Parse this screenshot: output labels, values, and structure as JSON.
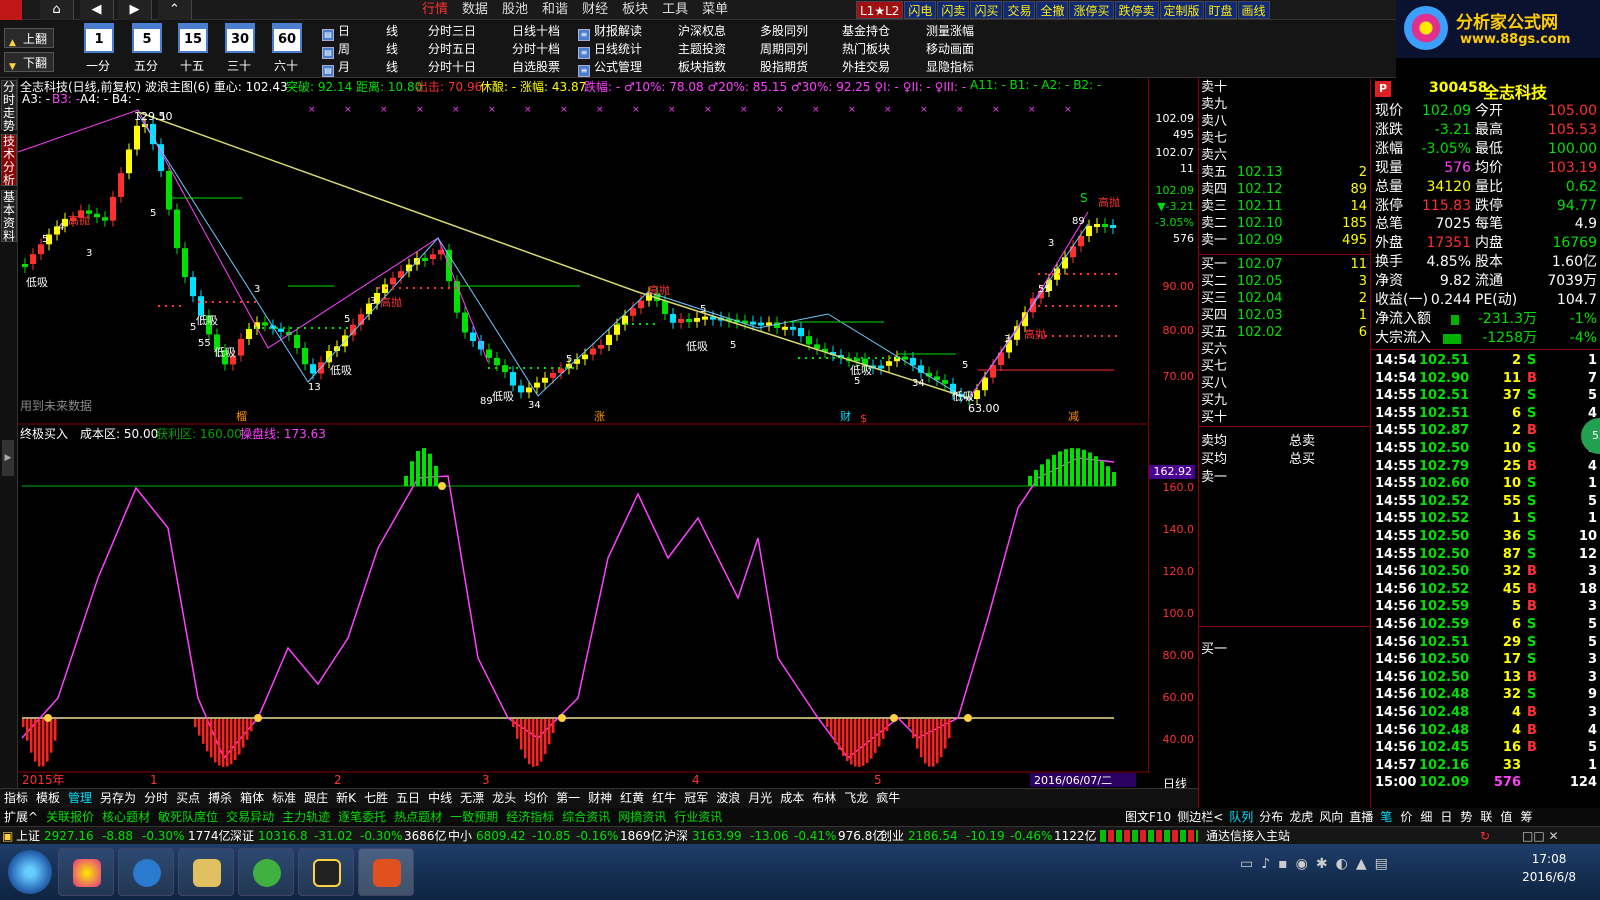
{
  "topbar": {
    "menu": [
      "行情",
      "数据",
      "股池",
      "和谐",
      "财经",
      "板块",
      "工具",
      "菜单"
    ],
    "tabs": [
      "L1★L2",
      "闪电",
      "闪卖",
      "闪买",
      "交易",
      "全撤",
      "涨停买",
      "跌停卖",
      "定制版",
      "盯盘",
      "画线"
    ]
  },
  "brand": {
    "name": "分析家公式网",
    "url": "www.88gs.com"
  },
  "toolbar": {
    "prev_page": "上翻",
    "next_page": "下翻",
    "periods": [
      {
        "num": "1",
        "label": "一分"
      },
      {
        "num": "5",
        "label": "五分"
      },
      {
        "num": "15",
        "label": "十五"
      },
      {
        "num": "30",
        "label": "三十"
      },
      {
        "num": "60",
        "label": "六十"
      }
    ],
    "cycle_rows": [
      {
        "day": "日",
        "line": "线"
      },
      {
        "day": "周",
        "line": "线"
      },
      {
        "day": "月",
        "line": "线"
      }
    ],
    "col1": [
      "分时三日",
      "分时五日",
      "分时十日"
    ],
    "col2": [
      "日线十档",
      "分时十档",
      "自选股票"
    ],
    "col3": [
      "财报解读",
      "日线统计",
      "公式管理"
    ],
    "col4": [
      "沪深权息",
      "主题投资",
      "板块指数"
    ],
    "col5": [
      "多股同列",
      "周期同列",
      "股指期货"
    ],
    "col6": [
      "基金持仓",
      "热门板块",
      "外挂交易"
    ],
    "col7": [
      "测量涨幅",
      "移动画面",
      "显隐指标"
    ]
  },
  "leftside": {
    "tab1": "分时走势",
    "tab2": "技术分析",
    "tab3": "基本资料"
  },
  "chart": {
    "info1": "全志科技(日线,前复权) 波浪主图(6) 重心: 102.43",
    "info2": "突破: 92.14 距离: 10.80",
    "info3": "出击: 70.96",
    "info4": "休酿:  - 涨幅: 43.87",
    "info5": "跌幅:  - ♂10%: 78.08 ♂20%: 85.15 ♂30%: 92.25 ♀I: - ♀II: - ♀III: -",
    "info6": "A11: - B1: - A2: - B2: -",
    "info7": "A3: -",
    "info8": "B3: -",
    "info9": "A4: - B4: -",
    "peak_label": "129.50",
    "low_label": "63.00",
    "future_note": "用到未来数据",
    "tags": [
      "低吸",
      "高抛",
      "低吸",
      "低吸",
      "低吸",
      "高抛",
      "低吸",
      "低吸",
      "高抛",
      "低吸",
      "低吸",
      "高抛",
      "高抛"
    ],
    "waves": [
      "5",
      "3",
      "4",
      "1",
      "5",
      "13",
      "5",
      "3",
      "89",
      "34",
      "55",
      "5",
      "3",
      "5",
      "5",
      "5",
      "89",
      "5",
      "34",
      "3",
      "5",
      "55",
      "3",
      "S"
    ],
    "bottom_marks": [
      "榴",
      "涨",
      "财",
      "$",
      "减"
    ]
  },
  "indicator": {
    "name": "终极买入",
    "cost": "成本区: 50.00",
    "profit": "获利区: 160.00",
    "line": "操盘线: 173.63",
    "marker": "162.92"
  },
  "price_axis": [
    "102.09",
    "495",
    "102.07",
    "11",
    "102.09",
    "▼-3.21",
    "-3.05%",
    "576",
    "90.00",
    "80.00",
    "70.00"
  ],
  "ind_axis": [
    "160.0",
    "140.0",
    "120.0",
    "100.0",
    "80.00",
    "60.00",
    "40.00"
  ],
  "xaxis": {
    "year": "2015年",
    "months": [
      "1",
      "2",
      "3",
      "4",
      "5"
    ],
    "date": "2016/06/07/二",
    "period": "日线"
  },
  "book": {
    "sells": [
      {
        "label": "卖十",
        "price": "",
        "vol": ""
      },
      {
        "label": "卖九",
        "price": "",
        "vol": ""
      },
      {
        "label": "卖八",
        "price": "",
        "vol": ""
      },
      {
        "label": "卖七",
        "price": "",
        "vol": ""
      },
      {
        "label": "卖六",
        "price": "",
        "vol": ""
      },
      {
        "label": "卖五",
        "price": "102.13",
        "vol": "2"
      },
      {
        "label": "卖四",
        "price": "102.12",
        "vol": "89"
      },
      {
        "label": "卖三",
        "price": "102.11",
        "vol": "14"
      },
      {
        "label": "卖二",
        "price": "102.10",
        "vol": "185"
      },
      {
        "label": "卖一",
        "price": "102.09",
        "vol": "495"
      }
    ],
    "buys": [
      {
        "label": "买一",
        "price": "102.07",
        "vol": "11"
      },
      {
        "label": "买二",
        "price": "102.05",
        "vol": "3"
      },
      {
        "label": "买三",
        "price": "102.04",
        "vol": "2"
      },
      {
        "label": "买四",
        "price": "102.03",
        "vol": "1"
      },
      {
        "label": "买五",
        "price": "102.02",
        "vol": "6"
      },
      {
        "label": "买六",
        "price": "",
        "vol": ""
      },
      {
        "label": "买七",
        "price": "",
        "vol": ""
      },
      {
        "label": "买八",
        "price": "",
        "vol": ""
      },
      {
        "label": "买九",
        "price": "",
        "vol": ""
      },
      {
        "label": "买十",
        "price": "",
        "vol": ""
      }
    ],
    "avg_sell": "卖均",
    "avg_buy": "买均",
    "total_sell": "总卖",
    "total_buy": "总买",
    "sell1": "卖一",
    "buy1": "买一"
  },
  "quote": {
    "code": "300458",
    "name": "全志科技",
    "rows": [
      {
        "l1": "现价",
        "v1": "102.09",
        "c1": "#00e000",
        "l2": "今开",
        "v2": "105.00",
        "c2": "#ff3030"
      },
      {
        "l1": "涨跌",
        "v1": "-3.21",
        "c1": "#00e000",
        "l2": "最高",
        "v2": "105.53",
        "c2": "#ff3030"
      },
      {
        "l1": "涨幅",
        "v1": "-3.05%",
        "c1": "#00e000",
        "l2": "最低",
        "v2": "100.00",
        "c2": "#00e000"
      },
      {
        "l1": "现量",
        "v1": "576",
        "c1": "#ff40ff",
        "l2": "均价",
        "v2": "103.19",
        "c2": "#ff3030"
      },
      {
        "l1": "总量",
        "v1": "34120",
        "c1": "#ffff00",
        "l2": "量比",
        "v2": "0.62",
        "c2": "#00e000"
      },
      {
        "l1": "涨停",
        "v1": "115.83",
        "c1": "#ff3030",
        "l2": "跌停",
        "v2": "94.77",
        "c2": "#00e000"
      },
      {
        "l1": "总笔",
        "v1": "7025",
        "c1": "#ffffff",
        "l2": "每笔",
        "v2": "4.9",
        "c2": "#ffffff"
      },
      {
        "l1": "外盘",
        "v1": "17351",
        "c1": "#ff3030",
        "l2": "内盘",
        "v2": "16769",
        "c2": "#00e000"
      },
      {
        "l1": "换手",
        "v1": "4.85%",
        "c1": "#ffffff",
        "l2": "股本",
        "v2": "1.60亿",
        "c2": "#ffffff"
      },
      {
        "l1": "净资",
        "v1": "9.82",
        "c1": "#ffffff",
        "l2": "流通",
        "v2": "7039万",
        "c2": "#ffffff"
      },
      {
        "l1": "收益(一)",
        "v1": "0.244",
        "c1": "#ffffff",
        "l2": "PE(动)",
        "v2": "104.7",
        "c2": "#ffffff"
      }
    ],
    "flow1_label": "净流入额",
    "flow1_val": "-231.3万",
    "flow1_pct": "-1%",
    "flow2_label": "大宗流入",
    "flow2_val": "-1258万",
    "flow2_pct": "-4%",
    "ticks": [
      {
        "t": "14:54",
        "p": "102.51",
        "v": "2",
        "d": "S",
        "n": "1"
      },
      {
        "t": "14:54",
        "p": "102.90",
        "v": "11",
        "d": "B",
        "n": "7"
      },
      {
        "t": "14:55",
        "p": "102.51",
        "v": "37",
        "d": "S",
        "n": "5"
      },
      {
        "t": "14:55",
        "p": "102.51",
        "v": "6",
        "d": "S",
        "n": "4"
      },
      {
        "t": "14:55",
        "p": "102.87",
        "v": "2",
        "d": "B",
        "n": "1"
      },
      {
        "t": "14:55",
        "p": "102.50",
        "v": "10",
        "d": "S",
        "n": "3"
      },
      {
        "t": "14:55",
        "p": "102.79",
        "v": "25",
        "d": "B",
        "n": "4"
      },
      {
        "t": "14:55",
        "p": "102.60",
        "v": "10",
        "d": "S",
        "n": "1"
      },
      {
        "t": "14:55",
        "p": "102.52",
        "v": "55",
        "d": "S",
        "n": "5"
      },
      {
        "t": "14:55",
        "p": "102.52",
        "v": "1",
        "d": "S",
        "n": "1"
      },
      {
        "t": "14:55",
        "p": "102.50",
        "v": "36",
        "d": "S",
        "n": "10"
      },
      {
        "t": "14:55",
        "p": "102.50",
        "v": "87",
        "d": "S",
        "n": "12"
      },
      {
        "t": "14:56",
        "p": "102.50",
        "v": "32",
        "d": "B",
        "n": "3"
      },
      {
        "t": "14:56",
        "p": "102.52",
        "v": "45",
        "d": "B",
        "n": "18"
      },
      {
        "t": "14:56",
        "p": "102.59",
        "v": "5",
        "d": "B",
        "n": "3"
      },
      {
        "t": "14:56",
        "p": "102.59",
        "v": "6",
        "d": "S",
        "n": "5"
      },
      {
        "t": "14:56",
        "p": "102.51",
        "v": "29",
        "d": "S",
        "n": "5"
      },
      {
        "t": "14:56",
        "p": "102.50",
        "v": "17",
        "d": "S",
        "n": "3"
      },
      {
        "t": "14:56",
        "p": "102.50",
        "v": "13",
        "d": "B",
        "n": "3"
      },
      {
        "t": "14:56",
        "p": "102.48",
        "v": "32",
        "d": "S",
        "n": "9"
      },
      {
        "t": "14:56",
        "p": "102.48",
        "v": "4",
        "d": "B",
        "n": "3"
      },
      {
        "t": "14:56",
        "p": "102.48",
        "v": "4",
        "d": "B",
        "n": "4"
      },
      {
        "t": "14:56",
        "p": "102.45",
        "v": "16",
        "d": "B",
        "n": "5"
      },
      {
        "t": "14:57",
        "p": "102.16",
        "v": "33",
        "d": "",
        "n": "1"
      },
      {
        "t": "15:00",
        "p": "102.09",
        "v": "576",
        "d": "",
        "n": "124"
      }
    ]
  },
  "bottom_tabs": [
    "指标",
    "模板",
    "管理",
    "另存为",
    "分时",
    "买点",
    "搏杀",
    "箱体",
    "标准",
    "跟庄",
    "新K",
    "七胜",
    "五日",
    "中线",
    "无漂",
    "龙头",
    "均价",
    "第一",
    "财神",
    "红黄",
    "红牛",
    "冠军",
    "波浪",
    "月光",
    "成本",
    "布林",
    "飞龙",
    "疯牛"
  ],
  "sub_tabs": [
    "扩展^",
    "关联报价",
    "核心题材",
    "敏死队席位",
    "交易异动",
    "主力轨迹",
    "逐笔委托",
    "热点题材",
    "一致预期",
    "经济指标",
    "综合资讯",
    "网摘资讯",
    "行业资讯"
  ],
  "right_tabs": {
    "ftab1": "图文F10",
    "ftab2": "侧边栏<",
    "ftab3": "队列",
    "ftab4": "分布",
    "ftab5": "龙虎",
    "ftab6": "风向",
    "ftab7": "直播",
    "ftab8": "笔",
    "ftab9": "价",
    "ftab10": "细",
    "ftab11": "日",
    "ftab12": "势",
    "ftab13": "联",
    "ftab14": "值",
    "ftab15": "筹"
  },
  "status": {
    "sh_l": "上证",
    "sh": "2927.16",
    "sh_c": "-8.88",
    "sh_p": "-0.30%",
    "sh_v": "1774亿",
    "sz_l": "深证",
    "sz": "10316.8",
    "sz_c": "-31.02",
    "sz_p": "-0.30%",
    "sz_v": "3686亿",
    "zx_l": "中小",
    "zx": "6809.42",
    "zx_c": "-10.85",
    "zx_p": "-0.16%",
    "zx_v": "1869亿",
    "hs_l": "沪深",
    "hs": "3163.99",
    "hs_c": "-13.06",
    "hs_p": "-0.41%",
    "hs_v": "976.8亿",
    "cy_l": "创业",
    "cy": "2186.54",
    "cy_c": "-10.19",
    "cy_p": "-0.46%",
    "cy_v": "1122亿",
    "conn": "通达信接入主站"
  },
  "taskbar": {
    "time": "17:08",
    "date": "2016/6/8"
  },
  "colors": {
    "up": "#ff3030",
    "down": "#00e000",
    "cyan": "#00e0ff",
    "yellow": "#ffff00",
    "purple": "#ff40ff",
    "axisline": "#8b0000"
  }
}
